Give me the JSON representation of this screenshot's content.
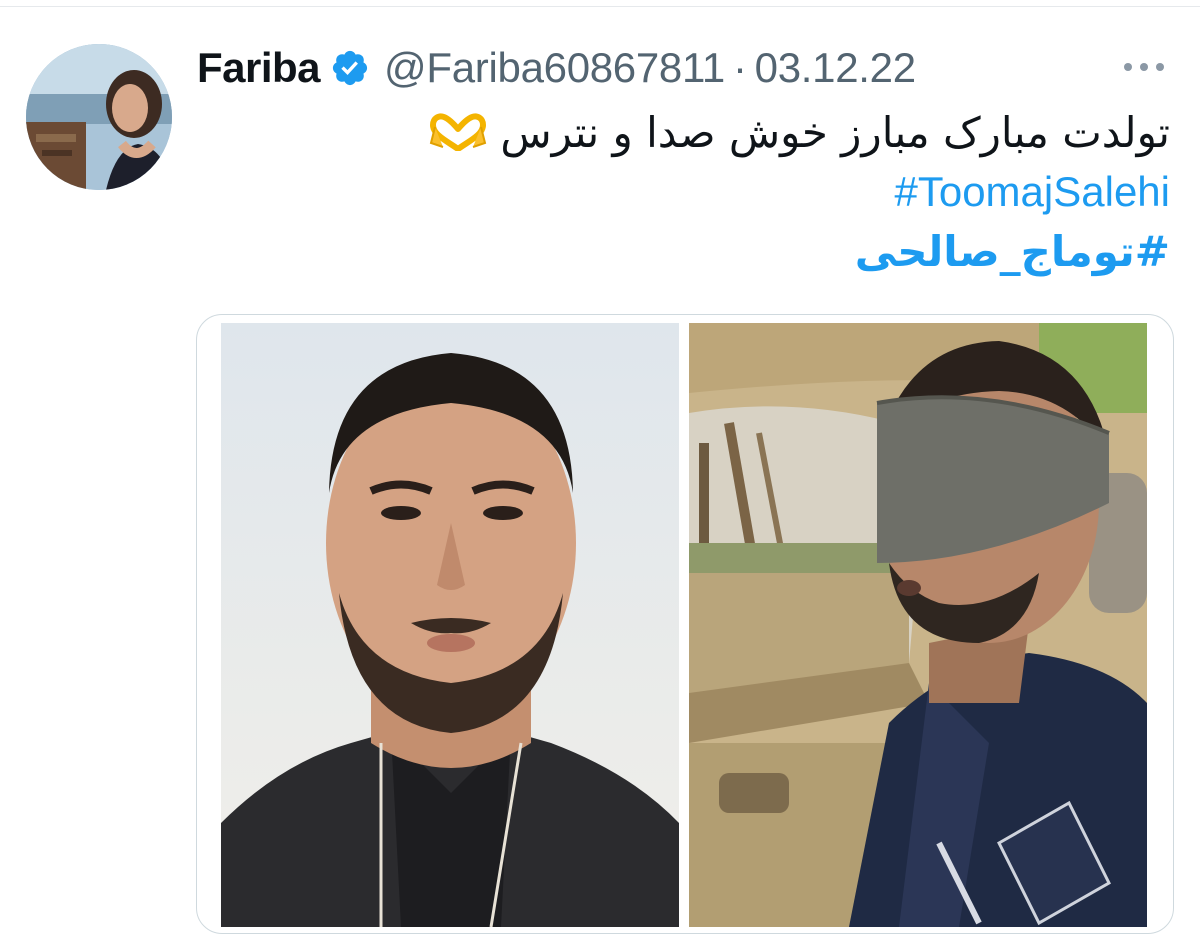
{
  "tweet": {
    "author": {
      "display_name": "Fariba",
      "handle": "@Fariba60867811",
      "verified_icon": "verified-badge-icon",
      "avatar_icon": "avatar"
    },
    "separator": "·",
    "date": "03.12.22",
    "more_icon": "ellipsis-icon",
    "text": "تولدت مبارک مبارز خوش صدا و نترس",
    "emoji_icon": "heart-hands-icon",
    "hashtags": [
      "#ToomajSalehi",
      "#توماج_صالحی"
    ],
    "media": [
      {
        "icon": "photo-man-portrait"
      },
      {
        "icon": "photo-man-blindfolded-in-car"
      }
    ]
  },
  "colors": {
    "link": "#1d9bf0",
    "text": "#0f1419",
    "secondary": "#536471",
    "verified": "#1d9bf0",
    "border": "#cfd9de"
  }
}
